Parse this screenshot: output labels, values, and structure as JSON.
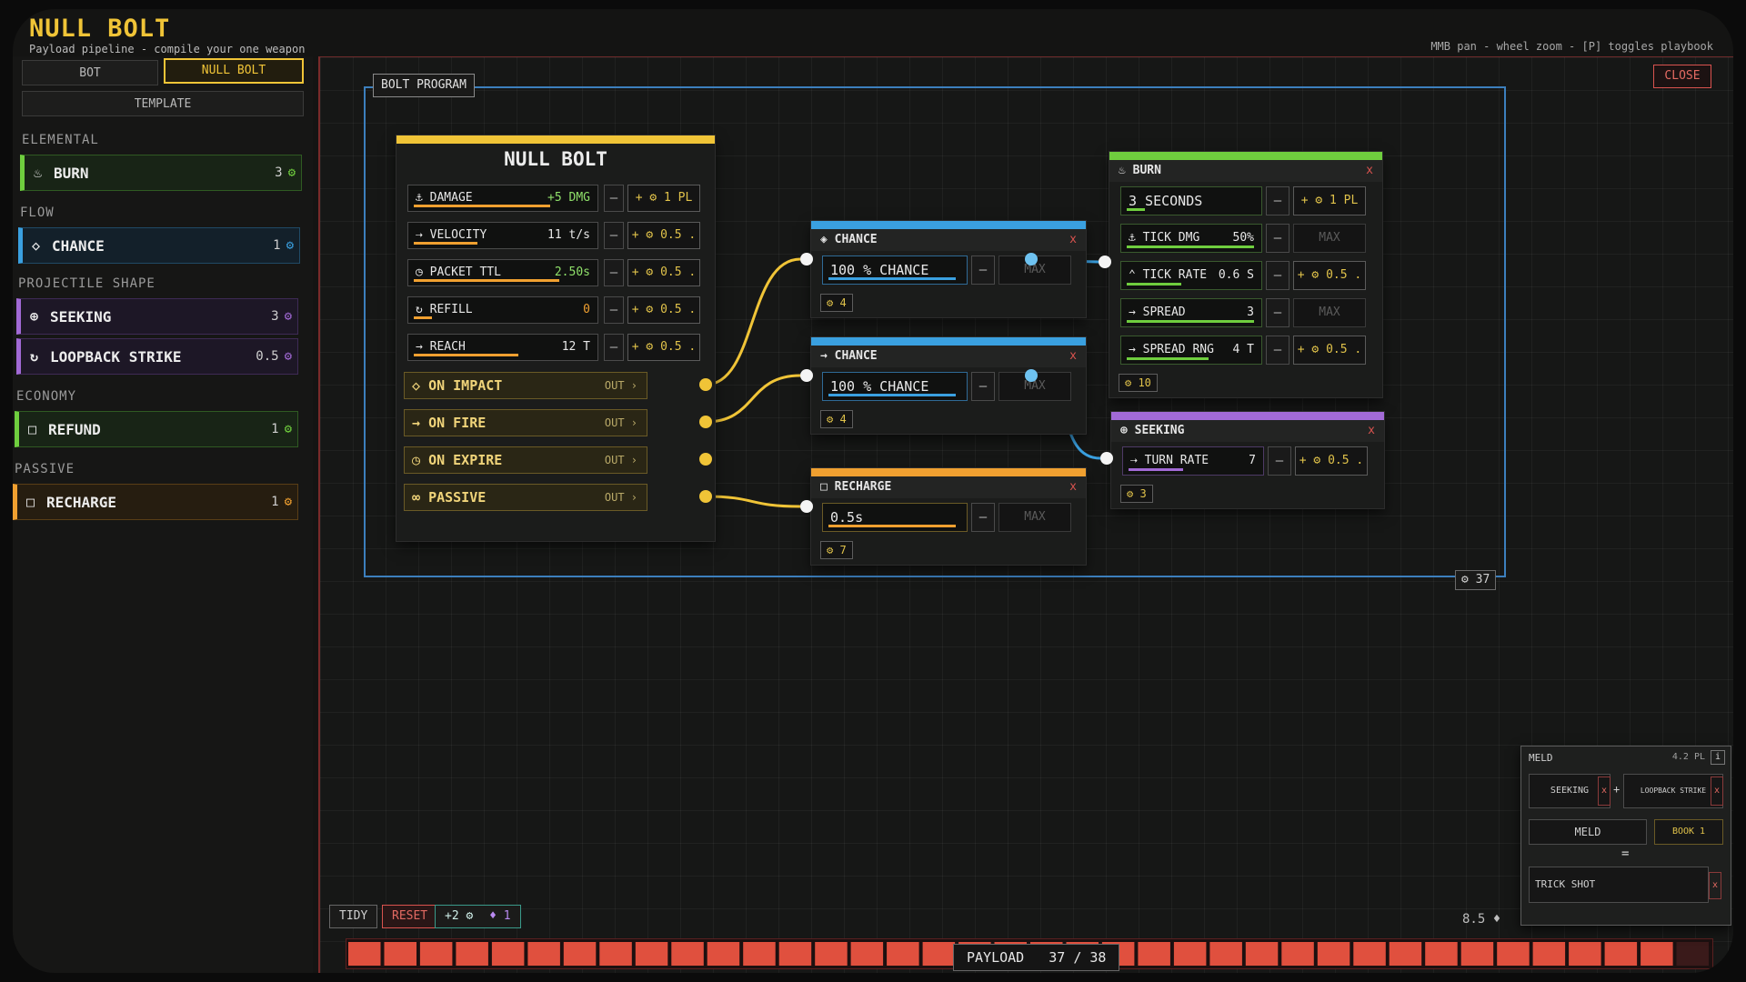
{
  "header": {
    "title": "NULL BOLT",
    "subtitle": "Payload pipeline - compile your one weapon",
    "hint": "MMB pan - wheel zoom - [P] toggles playbook"
  },
  "tabs": {
    "bot": "BOT",
    "null_bolt": "NULL BOLT",
    "template": "TEMPLATE"
  },
  "sidebar": {
    "categories": {
      "elemental": "ELEMENTAL",
      "flow": "FLOW",
      "projectile_shape": "PROJECTILE SHAPE",
      "economy": "ECONOMY",
      "passive": "PASSIVE"
    },
    "items": [
      {
        "label": "BURN",
        "cost": "3",
        "icon": "flame-icon",
        "color": "#6fce3e"
      },
      {
        "label": "CHANCE",
        "cost": "1",
        "icon": "diamond-icon",
        "color": "#3aa0e0"
      },
      {
        "label": "SEEKING",
        "cost": "3",
        "icon": "crosshair-icon",
        "color": "#a26ad6"
      },
      {
        "label": "LOOPBACK STRIKE",
        "cost": "0.5",
        "icon": "loop-icon",
        "color": "#a26ad6"
      },
      {
        "label": "REFUND",
        "cost": "1",
        "icon": "square-icon",
        "color": "#6fce3e"
      },
      {
        "label": "RECHARGE",
        "cost": "1",
        "icon": "square-icon",
        "color": "#f0a030"
      }
    ]
  },
  "canvas": {
    "close_label": "CLOSE",
    "program_label": "BOLT PROGRAM",
    "program_cost": "37"
  },
  "main_node": {
    "title": "NULL BOLT",
    "stats": [
      {
        "label": "DAMAGE",
        "value": "+5 DMG",
        "plus": "+ ⚙ 1 PL",
        "fill": 0.7
      },
      {
        "label": "VELOCITY",
        "value": "11 t/s",
        "plus": "+ ⚙ 0.5 .",
        "fill": 0.35
      },
      {
        "label": "PACKET TTL",
        "value": "2.50s",
        "plus": "+ ⚙ 0.5 .",
        "fill": 0.75
      },
      {
        "label": "REFILL",
        "value": "0",
        "plus": "+ ⚙ 0.5 .",
        "fill": 0.1
      },
      {
        "label": "REACH",
        "value": "12 T",
        "plus": "+ ⚙ 0.5 .",
        "fill": 0.55
      }
    ],
    "outputs": [
      {
        "label": "ON IMPACT",
        "out": "OUT ›"
      },
      {
        "label": "ON FIRE",
        "out": "OUT ›"
      },
      {
        "label": "ON EXPIRE",
        "out": "OUT ›"
      },
      {
        "label": "PASSIVE",
        "out": "OUT ›"
      }
    ],
    "minus": "–"
  },
  "chance1": {
    "title": "CHANCE",
    "field": "100 % CHANCE",
    "max": "MAX",
    "cost": "⚙ 4",
    "close": "x"
  },
  "chance2": {
    "title": "CHANCE",
    "field": "100 % CHANCE",
    "max": "MAX",
    "cost": "⚙ 4",
    "close": "x"
  },
  "recharge": {
    "title": "RECHARGE",
    "field": "0.5s",
    "max": "MAX",
    "cost": "⚙ 7",
    "close": "x"
  },
  "burn": {
    "title": "BURN",
    "close": "x",
    "rows": [
      {
        "label": "3 SECONDS",
        "value": "",
        "plus": "+ ⚙ 1 PL"
      },
      {
        "label": "TICK DMG",
        "value": "50%",
        "plus": "MAX"
      },
      {
        "label": "TICK RATE",
        "value": "0.6 S",
        "plus": "+ ⚙ 0.5 ."
      },
      {
        "label": "SPREAD",
        "value": "3",
        "plus": "MAX"
      },
      {
        "label": "SPREAD RNG",
        "value": "4 T",
        "plus": "+ ⚙ 0.5 ."
      }
    ],
    "cost": "⚙ 10"
  },
  "seeking": {
    "title": "SEEKING",
    "close": "x",
    "row": {
      "label": "TURN RATE",
      "value": "7",
      "plus": "+ ⚙ 0.5 ."
    },
    "cost": "⚙ 3"
  },
  "bottom": {
    "tidy": "TIDY",
    "reset": "RESET",
    "bonus": "+2 ⚙",
    "gems": "♦ 1",
    "payload_label": "PAYLOAD",
    "payload_value": "37 / 38",
    "payload_used": 37,
    "payload_max": 38,
    "side_value": "8.5 ♦"
  },
  "meld": {
    "title": "MELD",
    "cost": "4.2 PL",
    "info": "i",
    "slot_a": "SEEKING",
    "slot_b": "LOOPBACK STRIKE",
    "plus": "+",
    "meld_button": "MELD",
    "book_button": "BOOK 1",
    "equals": "=",
    "result": "TRICK SHOT",
    "close": "x"
  },
  "colors": {
    "accent": "#f0c437",
    "flow_blue": "#3aa0e0",
    "burn_green": "#6fce3e",
    "seeking_purple": "#a26ad6",
    "recharge_orange": "#f0a030",
    "payload_red": "#e0503e"
  }
}
